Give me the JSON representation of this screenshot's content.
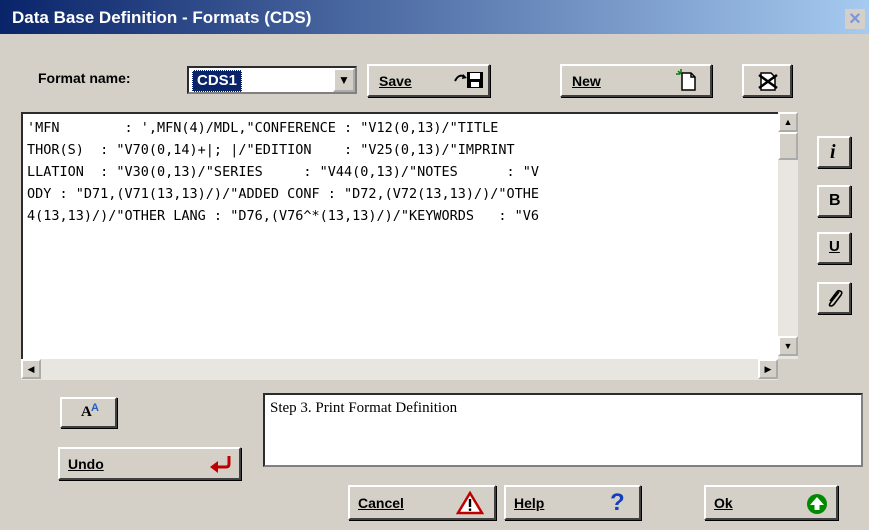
{
  "window": {
    "title": "Data Base Definition - Formats (CDS)",
    "close_label": "×"
  },
  "format_name": {
    "label": "Format name:",
    "value": "CDS1"
  },
  "toolbar": {
    "save_label": "Save",
    "new_label": "New"
  },
  "editor": {
    "text": "'MFN        : ',MFN(4)/MDL,\"CONFERENCE : \"V12(0,13)/\"TITLE\nTHOR(S)  : \"V70(0,14)+|; |/\"EDITION    : \"V25(0,13)/\"IMPRINT\nLLATION  : \"V30(0,13)/\"SERIES     : \"V44(0,13)/\"NOTES      : \"V\nODY : \"D71,(V71(13,13)/)/\"ADDED CONF : \"D72,(V72(13,13)/)/\"OTHE\n4(13,13)/)/\"OTHER LANG : \"D76,(V76^*(13,13)/)/\"KEYWORDS   : \"V6"
  },
  "side_buttons": {
    "italic_label": "i",
    "bold_label": "B",
    "underline_label": "U"
  },
  "font_button_label": "A",
  "undo_label": "Undo",
  "status_text": "Step 3. Print Format Definition",
  "footer": {
    "cancel_label": "Cancel",
    "help_label": "Help",
    "ok_label": "Ok"
  }
}
